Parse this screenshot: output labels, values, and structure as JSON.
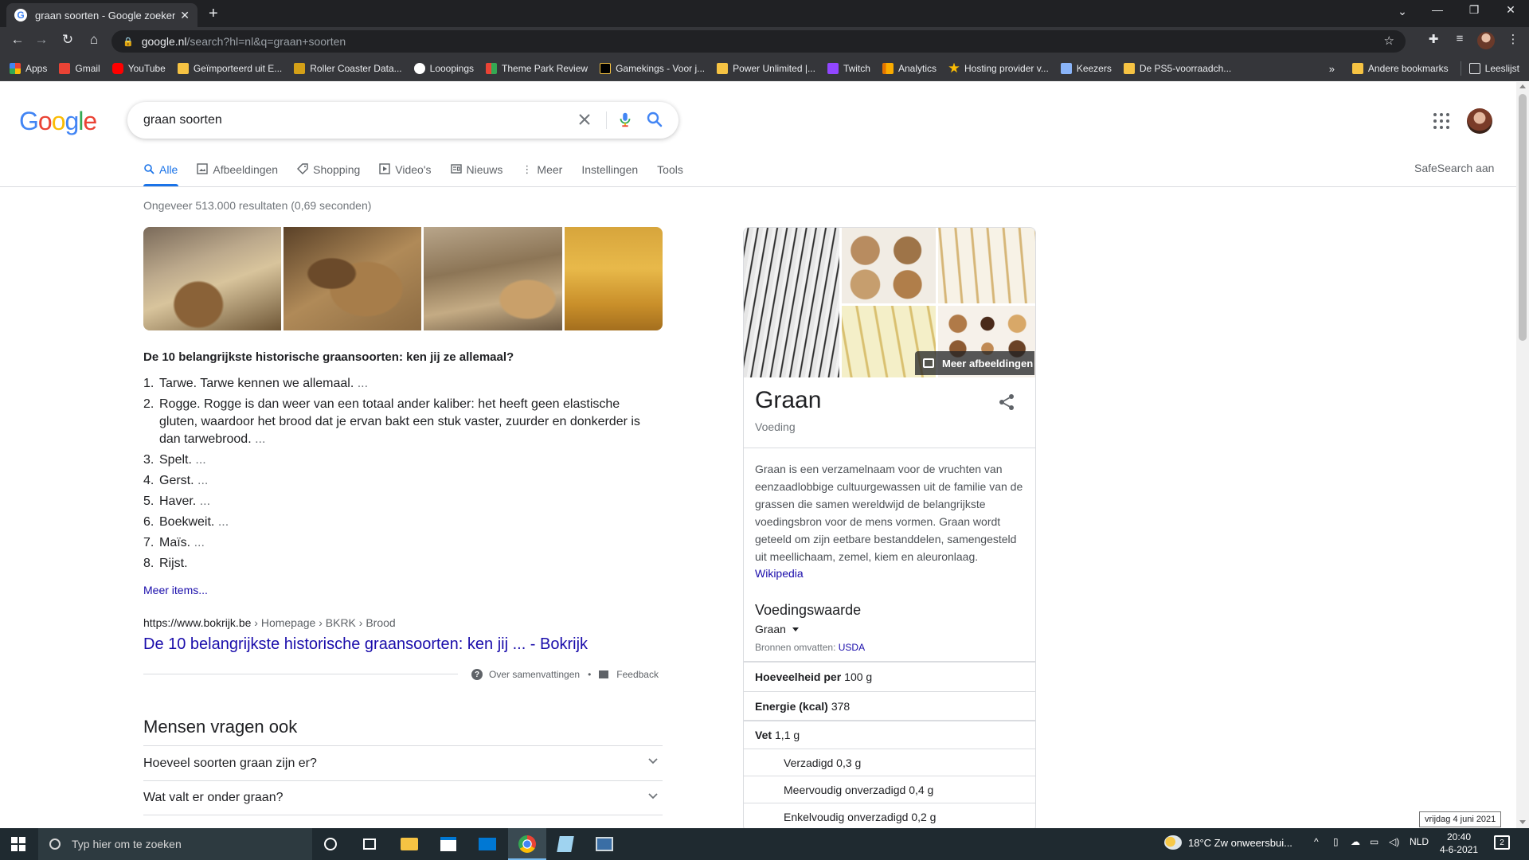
{
  "browser": {
    "tab_title": "graan soorten - Google zoeken",
    "url_domain": "google.nl",
    "url_path": "/search?hl=nl&q=graan+soorten",
    "bookmarks": [
      {
        "label": "Apps",
        "color": "#ea4335"
      },
      {
        "label": "Gmail",
        "color": "#ea4335"
      },
      {
        "label": "YouTube",
        "color": "#ff0000"
      },
      {
        "label": "Geïmporteerd uit E...",
        "color": "#f6c343"
      },
      {
        "label": "Roller Coaster Data...",
        "color": "#d4a017"
      },
      {
        "label": "Looopings",
        "color": "#ffffff"
      },
      {
        "label": "Theme Park Review",
        "color": "#34a853"
      },
      {
        "label": "Gamekings - Voor j...",
        "color": "#f6c343"
      },
      {
        "label": "Power Unlimited |...",
        "color": "#f6c343"
      },
      {
        "label": "Twitch",
        "color": "#9146ff"
      },
      {
        "label": "Analytics",
        "color": "#f9ab00"
      },
      {
        "label": "Hosting provider v...",
        "color": "#fbbc04"
      },
      {
        "label": "Keezers",
        "color": "#8ab4f8"
      },
      {
        "label": "De PS5-voorraadch...",
        "color": "#f6c343"
      }
    ],
    "bookmarks_overflow": "»",
    "other_bookmarks": "Andere bookmarks",
    "reading_list": "Leeslijst"
  },
  "google": {
    "logo": [
      "G",
      "o",
      "o",
      "g",
      "l",
      "e"
    ],
    "logo_colors": [
      "#4285f4",
      "#ea4335",
      "#fbbc05",
      "#4285f4",
      "#34a853",
      "#ea4335"
    ],
    "query": "graan soorten",
    "tabs": [
      {
        "label": "Alle",
        "icon": "search-icon"
      },
      {
        "label": "Afbeeldingen",
        "icon": "image-icon"
      },
      {
        "label": "Shopping",
        "icon": "tag-icon"
      },
      {
        "label": "Video's",
        "icon": "play-icon"
      },
      {
        "label": "Nieuws",
        "icon": "news-icon"
      },
      {
        "label": "Meer",
        "icon": "more-vert-icon"
      },
      {
        "label": "Instellingen"
      },
      {
        "label": "Tools"
      }
    ],
    "safesearch": "SafeSearch aan"
  },
  "results": {
    "stats": "Ongeveer 513.000 resultaten (0,69 seconden)",
    "snippet_title": "De 10 belangrijkste historische graansoorten: ken jij ze allemaal?",
    "snippet_items": [
      {
        "num": "1.",
        "text": "Tarwe. Tarwe kennen we allemaal.",
        "ell": " ..."
      },
      {
        "num": "2.",
        "text": "Rogge. Rogge is dan weer van een totaal ander kaliber: het heeft geen elastische gluten, waardoor het brood dat je ervan bakt een stuk vaster, zuurder en donkerder is dan tarwebrood.",
        "ell": " ..."
      },
      {
        "num": "3.",
        "text": "Spelt.",
        "ell": " ..."
      },
      {
        "num": "4.",
        "text": "Gerst.",
        "ell": " ..."
      },
      {
        "num": "5.",
        "text": "Haver.",
        "ell": " ..."
      },
      {
        "num": "6.",
        "text": "Boekweit.",
        "ell": " ..."
      },
      {
        "num": "7.",
        "text": "Maïs.",
        "ell": " ..."
      },
      {
        "num": "8.",
        "text": "Rijst.",
        "ell": ""
      }
    ],
    "more_items": "Meer items...",
    "source_url": "https://www.bokrijk.be",
    "source_crumbs": " › Homepage › BKRK › Brood",
    "source_title": "De 10 belangrijkste historische graansoorten: ken jij ... - Bokrijk",
    "about_snippets": "Over samenvattingen",
    "feedback": "Feedback",
    "paa_title": "Mensen vragen ook",
    "paa": [
      "Hoeveel soorten graan zijn er?",
      "Wat valt er onder graan?"
    ]
  },
  "knowledge_panel": {
    "more_images": "Meer afbeeldingen",
    "title": "Graan",
    "subtitle": "Voeding",
    "description": "Graan is een verzamelnaam voor de vruchten van eenzaadlobbige cultuurgewassen uit de familie van de grassen die samen wereldwijd de belangrijkste voedingsbron voor de mens vormen. Graan wordt geteeld om zijn eetbare bestanddelen, samengesteld uit meellichaam, zemel, kiem en aleuronlaag.",
    "wiki": "Wikipedia",
    "nutrition_title": "Voedingswaarde",
    "nutrition_select": "Graan",
    "sources_prefix": "Bronnen omvatten: ",
    "sources_link": "USDA",
    "rows": [
      {
        "label": "Hoeveelheid per",
        "value": "100 g"
      },
      {
        "label": "Energie (kcal)",
        "value": "378"
      },
      {
        "label": "Vet",
        "value": "1,1 g"
      },
      {
        "label": "",
        "value": "Verzadigd 0,3 g"
      },
      {
        "label": "",
        "value": "Meervoudig onverzadigd 0,4 g"
      },
      {
        "label": "",
        "value": "Enkelvoudig onverzadigd 0,2 g"
      }
    ]
  },
  "taskbar": {
    "search_placeholder": "Typ hier om te zoeken",
    "weather": "18°C  Zw onweersbui...",
    "lang": "NLD",
    "time": "20:40",
    "date": "4-6-2021",
    "date_tooltip": "vrijdag 4 juni 2021",
    "notifications": "2"
  }
}
